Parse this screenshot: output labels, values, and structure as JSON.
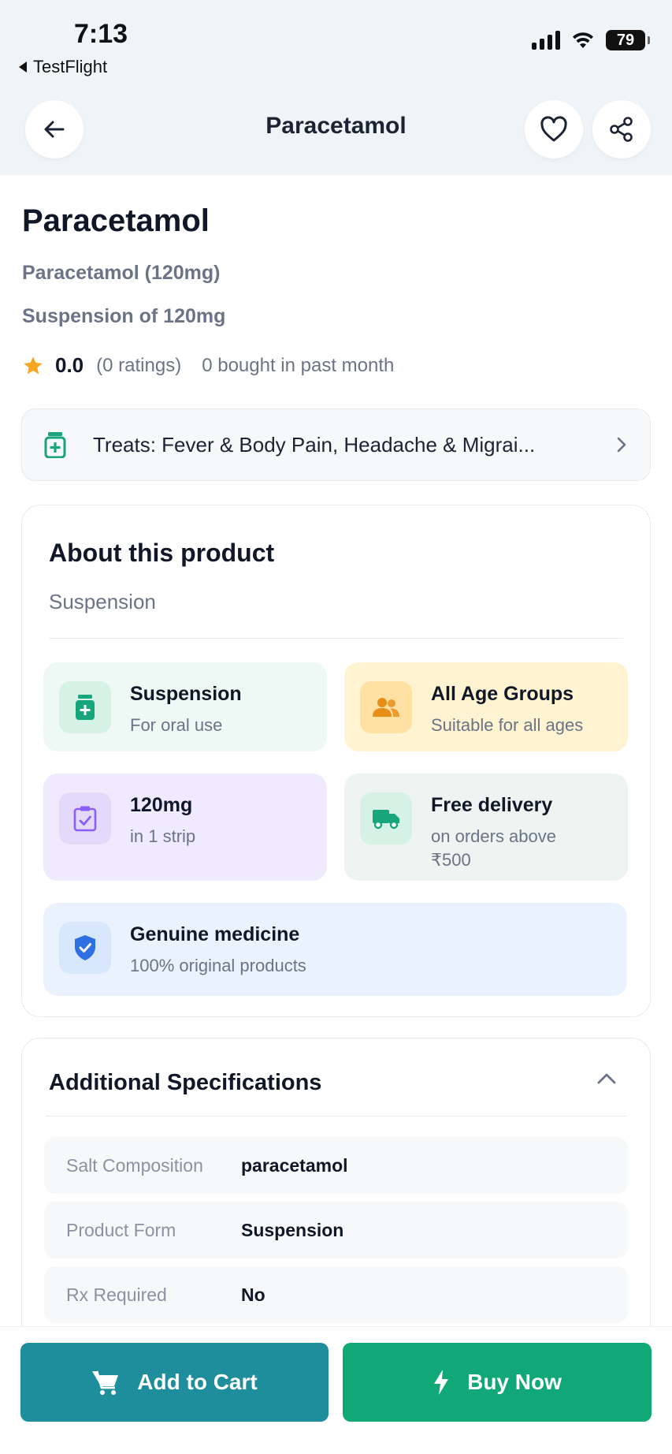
{
  "status": {
    "time": "7:13",
    "back_app": "TestFlight",
    "battery": "79"
  },
  "header": {
    "title": "Paracetamol"
  },
  "product": {
    "name": "Paracetamol",
    "subtitle": "Paracetamol (120mg)",
    "form_line": "Suspension of 120mg",
    "rating_score": "0.0",
    "ratings_count": "(0 ratings)",
    "bought": "0 bought in past month"
  },
  "treats": {
    "text": "Treats: Fever & Body Pain, Headache & Migrai..."
  },
  "about": {
    "title": "About this product",
    "subtitle": "Suspension",
    "features": [
      {
        "title": "Suspension",
        "desc": "For oral use",
        "bg": "#eef9f5",
        "icon_bg": "#d6f2e7",
        "icon_color": "#17a57b"
      },
      {
        "title": "All Age Groups",
        "desc": "Suitable for all ages",
        "bg": "#fff3d1",
        "icon_bg": "#ffe2a3",
        "icon_color": "#e88d18"
      },
      {
        "title": "120mg",
        "desc": "in 1 strip",
        "bg": "#efeafd",
        "icon_bg": "#e2d9fb",
        "icon_color": "#8b5cf6"
      },
      {
        "title": "Free delivery",
        "desc": "on orders above ₹500",
        "bg": "#eef4f2",
        "icon_bg": "#d6f2e7",
        "icon_color": "#17a57b"
      },
      {
        "title": "Genuine medicine",
        "desc": "100% original products",
        "bg": "#eaf2fe",
        "icon_bg": "#d9e7fd",
        "icon_color": "#2f6fe4"
      }
    ]
  },
  "specs": {
    "title": "Additional Specifications",
    "rows": [
      {
        "key": "Salt Composition",
        "value": "paracetamol"
      },
      {
        "key": "Product Form",
        "value": "Suspension"
      },
      {
        "key": "Rx Required",
        "value": "No"
      }
    ]
  },
  "actions": {
    "add_to_cart": "Add to Cart",
    "buy_now": "Buy Now",
    "cart_color": "#1f8e9c",
    "buy_color": "#10a877"
  }
}
